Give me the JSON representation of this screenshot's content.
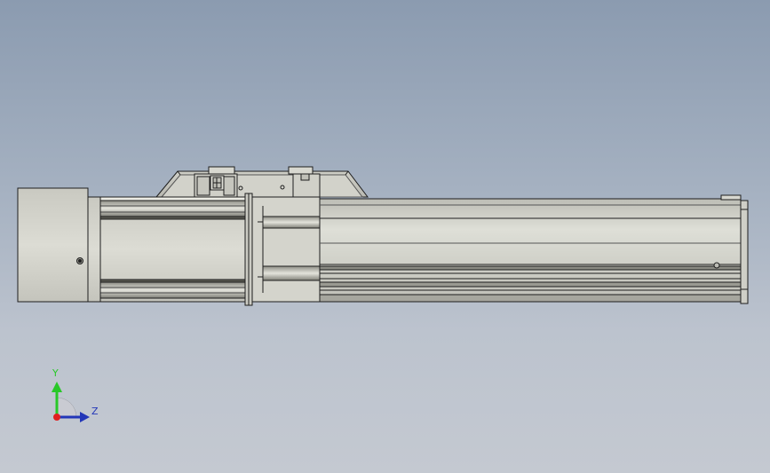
{
  "viewport": {
    "background_top": "#8b9bb0",
    "background_bottom": "#c4c9d1"
  },
  "model": {
    "body_color": "#d3d3cb",
    "edge_color": "#1e1e1e",
    "shadow_color": "#7a7a72"
  },
  "triad": {
    "y_label": "Y",
    "z_label": "Z",
    "y_color": "#28c828",
    "z_color": "#2236b8",
    "x_color": "#e02020"
  }
}
